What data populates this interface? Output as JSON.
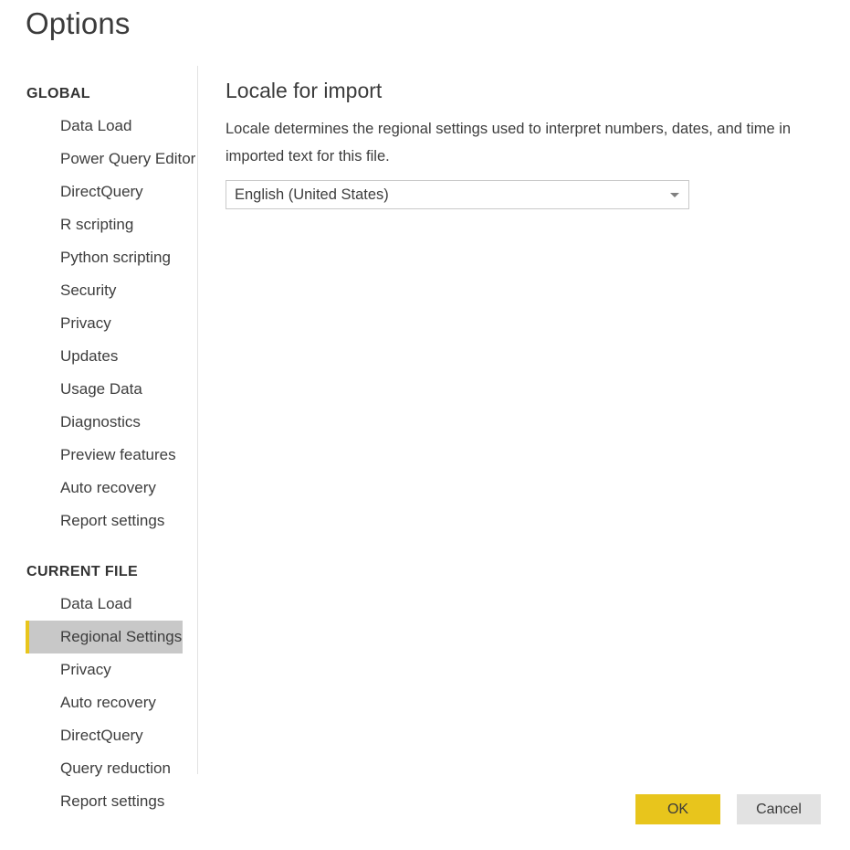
{
  "window": {
    "title": "Options"
  },
  "sidebar": {
    "groups": [
      {
        "header": "GLOBAL",
        "items": [
          {
            "label": "Data Load",
            "selected": false
          },
          {
            "label": "Power Query Editor",
            "selected": false
          },
          {
            "label": "DirectQuery",
            "selected": false
          },
          {
            "label": "R scripting",
            "selected": false
          },
          {
            "label": "Python scripting",
            "selected": false
          },
          {
            "label": "Security",
            "selected": false
          },
          {
            "label": "Privacy",
            "selected": false
          },
          {
            "label": "Updates",
            "selected": false
          },
          {
            "label": "Usage Data",
            "selected": false
          },
          {
            "label": "Diagnostics",
            "selected": false
          },
          {
            "label": "Preview features",
            "selected": false
          },
          {
            "label": "Auto recovery",
            "selected": false
          },
          {
            "label": "Report settings",
            "selected": false
          }
        ]
      },
      {
        "header": "CURRENT FILE",
        "items": [
          {
            "label": "Data Load",
            "selected": false
          },
          {
            "label": "Regional Settings",
            "selected": true
          },
          {
            "label": "Privacy",
            "selected": false
          },
          {
            "label": "Auto recovery",
            "selected": false
          },
          {
            "label": "DirectQuery",
            "selected": false
          },
          {
            "label": "Query reduction",
            "selected": false
          },
          {
            "label": "Report settings",
            "selected": false
          }
        ]
      }
    ]
  },
  "content": {
    "heading": "Locale for import",
    "description": "Locale determines the regional settings used to interpret numbers, dates, and time in imported text for this file.",
    "locale_dropdown": {
      "value": "English (United States)",
      "caret_icon": "chevron-down-icon"
    }
  },
  "footer": {
    "ok_label": "OK",
    "cancel_label": "Cancel"
  },
  "colors": {
    "accent_gold": "#e8c51c",
    "selected_row": "#c8c8c8",
    "cancel_button": "#e2e2e2",
    "divider": "#e2e2e2",
    "text": "#3d3d3d"
  }
}
